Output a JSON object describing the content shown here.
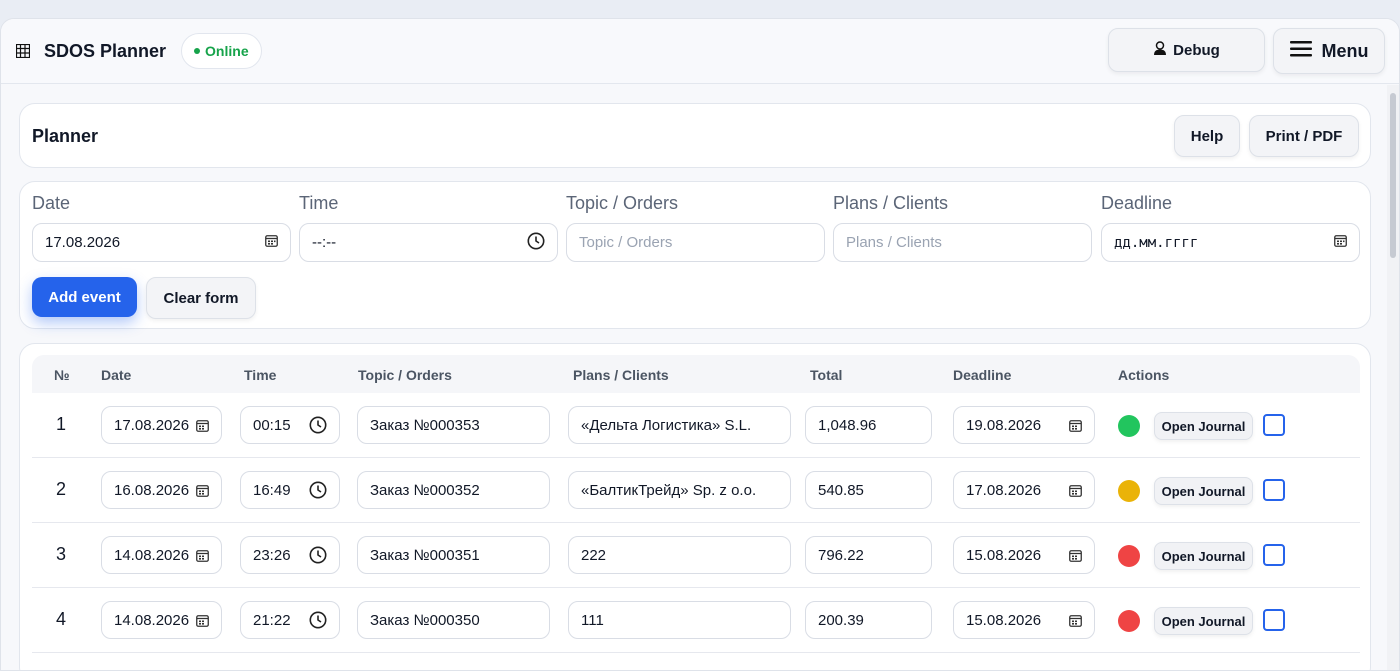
{
  "app": {
    "title": "SDOS Planner",
    "status": "Online",
    "debug_label": "Debug",
    "menu_label": "Menu"
  },
  "planner": {
    "title": "Planner",
    "help_label": "Help",
    "print_label": "Print / PDF"
  },
  "form": {
    "date": {
      "label": "Date",
      "value": "17.08.2026"
    },
    "time": {
      "label": "Time",
      "value": "--:--"
    },
    "topic": {
      "label": "Topic / Orders",
      "placeholder": "Topic / Orders"
    },
    "plans": {
      "label": "Plans / Clients",
      "placeholder": "Plans / Clients"
    },
    "deadline": {
      "label": "Deadline",
      "value": "дд.мм.гггг"
    },
    "add_label": "Add event",
    "clear_label": "Clear form"
  },
  "table": {
    "headers": {
      "num": "№",
      "date": "Date",
      "time": "Time",
      "topic": "Topic / Orders",
      "plans": "Plans / Clients",
      "total": "Total",
      "deadline": "Deadline",
      "actions": "Actions"
    },
    "rows": [
      {
        "num": "1",
        "date": "17.08.2026",
        "time": "00:15",
        "topic": "Заказ №000353",
        "plans": "«Дельта Логистика» S.L.",
        "total": "1,048.96",
        "deadline": "19.08.2026",
        "status_color": "#22c55e",
        "journal_label": "Open Journal"
      },
      {
        "num": "2",
        "date": "16.08.2026",
        "time": "16:49",
        "topic": "Заказ №000352",
        "plans": "«БалтикТрейд» Sp. z o.o.",
        "total": "540.85",
        "deadline": "17.08.2026",
        "status_color": "#eab308",
        "journal_label": "Open Journal"
      },
      {
        "num": "3",
        "date": "14.08.2026",
        "time": "23:26",
        "topic": "Заказ №000351",
        "plans": "222",
        "total": "796.22",
        "deadline": "15.08.2026",
        "status_color": "#ef4444",
        "journal_label": "Open Journal"
      },
      {
        "num": "4",
        "date": "14.08.2026",
        "time": "21:22",
        "topic": "Заказ №000350",
        "plans": "111",
        "total": "200.39",
        "deadline": "15.08.2026",
        "status_color": "#ef4444",
        "journal_label": "Open Journal"
      }
    ]
  },
  "colors": {
    "accent": "#2563eb",
    "online": "#16a34a"
  }
}
